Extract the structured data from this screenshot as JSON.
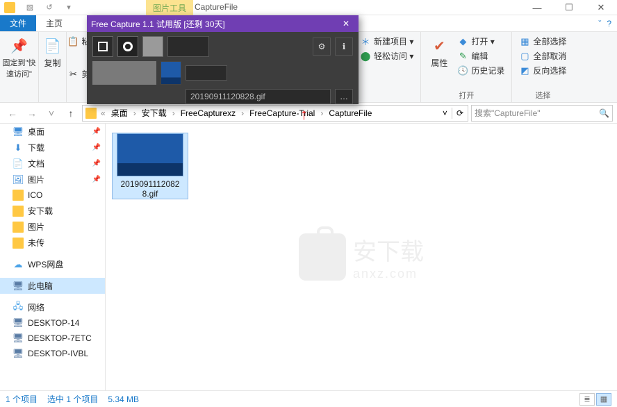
{
  "window": {
    "contextual_tab": "图片工具",
    "folder_title": "CaptureFile",
    "win_min": "—",
    "win_max": "☐",
    "win_close": "✕",
    "expand": "ˇ",
    "help": "?"
  },
  "tabs": {
    "file": "文件",
    "home": "主页"
  },
  "ribbon": {
    "pin": {
      "label": "固定到\"快\n速访问\"",
      "group": ""
    },
    "copy": {
      "label": "复制"
    },
    "paste": {
      "label": "粘"
    },
    "cut": {
      "label": "剪"
    },
    "clipboard_group": "",
    "new_item": "新建项目 ▾",
    "easy_access": "轻松访问 ▾",
    "new_group": "",
    "properties": "属性",
    "open_with": "打开 ▾",
    "edit": "编辑",
    "history": "历史记录",
    "open_group": "打开",
    "select_all": "全部选择",
    "select_none": "全部取消",
    "select_invert": "反向选择",
    "select_group": "选择"
  },
  "breadcrumb": {
    "back_chev": "«",
    "items": [
      "桌面",
      "安下载",
      "FreeCapturexz",
      "FreeCapture-Trial",
      "CaptureFile"
    ],
    "sep": "›",
    "dropdown": "˅",
    "refresh": "⟳"
  },
  "search": {
    "placeholder": "搜索\"CaptureFile\""
  },
  "nav": {
    "desktop": "桌面",
    "downloads": "下载",
    "documents": "文档",
    "pictures": "图片",
    "ico": "ICO",
    "anxz": "安下载",
    "pictures2": "图片",
    "weichuan": "未传",
    "wps": "WPS网盘",
    "thispc": "此电脑",
    "network": "网络",
    "pc1": "DESKTOP-14",
    "pc2": "DESKTOP-7ETC",
    "pc3": "DESKTOP-IVBL"
  },
  "files": [
    {
      "name": "2019091112082\n8.gif"
    }
  ],
  "watermark": {
    "title": "安下载",
    "sub": "anxz.com"
  },
  "status": {
    "count": "1 个项目",
    "selection": "选中 1 个项目",
    "size": "5.34 MB"
  },
  "overlay": {
    "title": "Free Capture 1.1 试用版 [还剩 30天]",
    "close": "✕",
    "filename": "20190911120828.gif",
    "ellipsis": "…",
    "gear": "⚙",
    "info": "ℹ"
  }
}
